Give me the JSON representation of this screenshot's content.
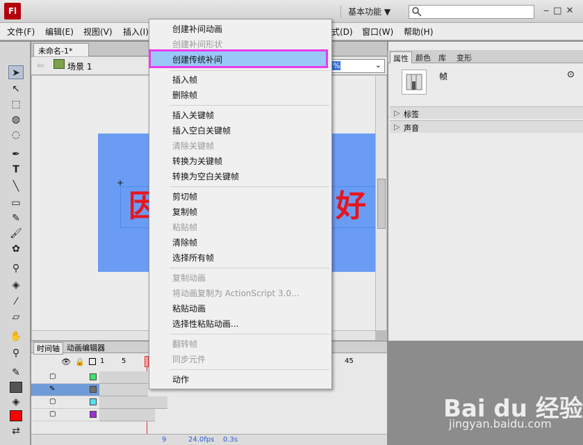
{
  "app": {
    "logo": "Fl",
    "workspace": "基本功能 ▼",
    "window_controls": "‒□✕"
  },
  "menubar": {
    "items": [
      "文件(F)",
      "编辑(E)",
      "视图(V)",
      "插入(I)",
      "式(D)",
      "窗口(W)",
      "帮助(H)"
    ]
  },
  "document": {
    "tab": "未命名-1*",
    "tab_close": "×",
    "scene": "场景 1",
    "zoom": "%"
  },
  "stage": {
    "left_text": "因",
    "right_text": "好",
    "text_color": "#e8151c",
    "bg_color": "#6b9cf4"
  },
  "properties": {
    "tabs": [
      "属性",
      "颜色",
      "库",
      "变形"
    ],
    "frame_label": "帧",
    "sections": [
      "标签",
      "声音"
    ]
  },
  "timeline": {
    "tabs": [
      "时间轴",
      "动画编辑器"
    ],
    "ruler": [
      "1",
      "5",
      "45"
    ],
    "fps": "24.0fps",
    "time": "0.3s",
    "frame": "9",
    "layers": [
      {
        "color": "#3ce66b"
      },
      {
        "color": "#6e6e6e"
      },
      {
        "color": "#4fe4ef"
      },
      {
        "color": "#9b2fd6"
      }
    ]
  },
  "context_menu": {
    "items": [
      {
        "label": "创建补间动画",
        "enabled": true
      },
      {
        "label": "创建补间形状",
        "enabled": false
      },
      {
        "label": "创建传统补间",
        "enabled": true
      },
      {
        "label": "插入帧",
        "enabled": true
      },
      {
        "label": "删除帧",
        "enabled": true
      },
      {
        "label": "插入关键帧",
        "enabled": true
      },
      {
        "label": "插入空白关键帧",
        "enabled": true
      },
      {
        "label": "清除关键帧",
        "enabled": false
      },
      {
        "label": "转换为关键帧",
        "enabled": true
      },
      {
        "label": "转换为空白关键帧",
        "enabled": true
      },
      {
        "label": "剪切帧",
        "enabled": true
      },
      {
        "label": "复制帧",
        "enabled": true
      },
      {
        "label": "粘贴帧",
        "enabled": false
      },
      {
        "label": "清除帧",
        "enabled": true
      },
      {
        "label": "选择所有帧",
        "enabled": true
      },
      {
        "label": "复制动画",
        "enabled": false
      },
      {
        "label": "将动画复制为 ActionScript 3.0...",
        "enabled": false
      },
      {
        "label": "粘贴动画",
        "enabled": true
      },
      {
        "label": "选择性粘贴动画...",
        "enabled": true
      },
      {
        "label": "翻转帧",
        "enabled": false
      },
      {
        "label": "同步元件",
        "enabled": false
      },
      {
        "label": "动作",
        "enabled": true
      }
    ]
  },
  "watermark": {
    "brand": "Bai du 经验",
    "url": "jingyan.baidu.com"
  }
}
